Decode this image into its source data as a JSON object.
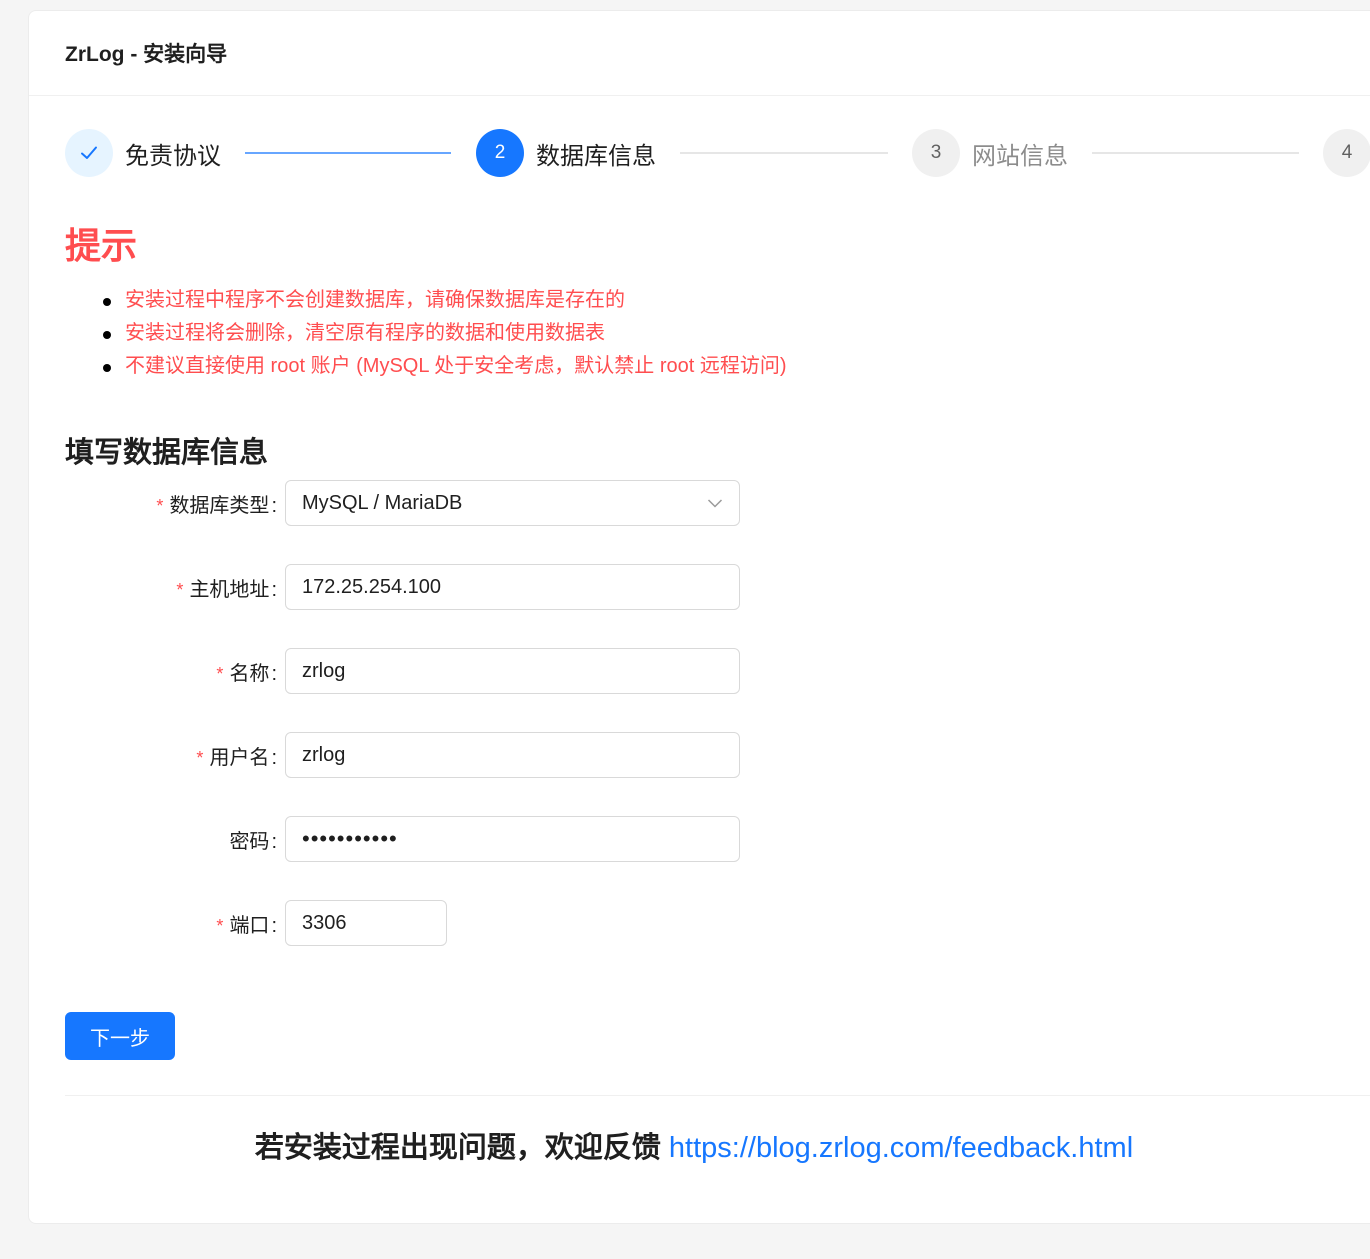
{
  "header": {
    "title": "ZrLog - 安装向导"
  },
  "steps": [
    {
      "label": "免责协议",
      "number": "",
      "status": "done"
    },
    {
      "label": "数据库信息",
      "number": "2",
      "status": "active"
    },
    {
      "label": "网站信息",
      "number": "3",
      "status": "wait"
    },
    {
      "label": "",
      "number": "4",
      "status": "wait"
    }
  ],
  "tips": {
    "title": "提示",
    "items": [
      "安装过程中程序不会创建数据库，请确保数据库是存在的",
      "安装过程将会删除，清空原有程序的数据和使用数据表",
      "不建议直接使用 root 账户 (MySQL 处于安全考虑，默认禁止 root 远程访问)"
    ]
  },
  "form": {
    "title": "填写数据库信息",
    "required_mark": "*",
    "colon": ":",
    "db_type": {
      "label": "数据库类型",
      "value": "MySQL / MariaDB"
    },
    "host": {
      "label": "主机地址",
      "value": "172.25.254.100"
    },
    "name": {
      "label": "名称",
      "value": "zrlog"
    },
    "username": {
      "label": "用户名",
      "value": "zrlog"
    },
    "password": {
      "label": "密码",
      "value": "•••••••••••"
    },
    "port": {
      "label": "端口",
      "value": "3306"
    }
  },
  "actions": {
    "next_label": "下一步"
  },
  "footer": {
    "text": "若安装过程出现问题，欢迎反馈",
    "link": "https://blog.zrlog.com/feedback.html"
  },
  "colors": {
    "primary": "#1677ff",
    "danger": "#ff4d4f"
  }
}
